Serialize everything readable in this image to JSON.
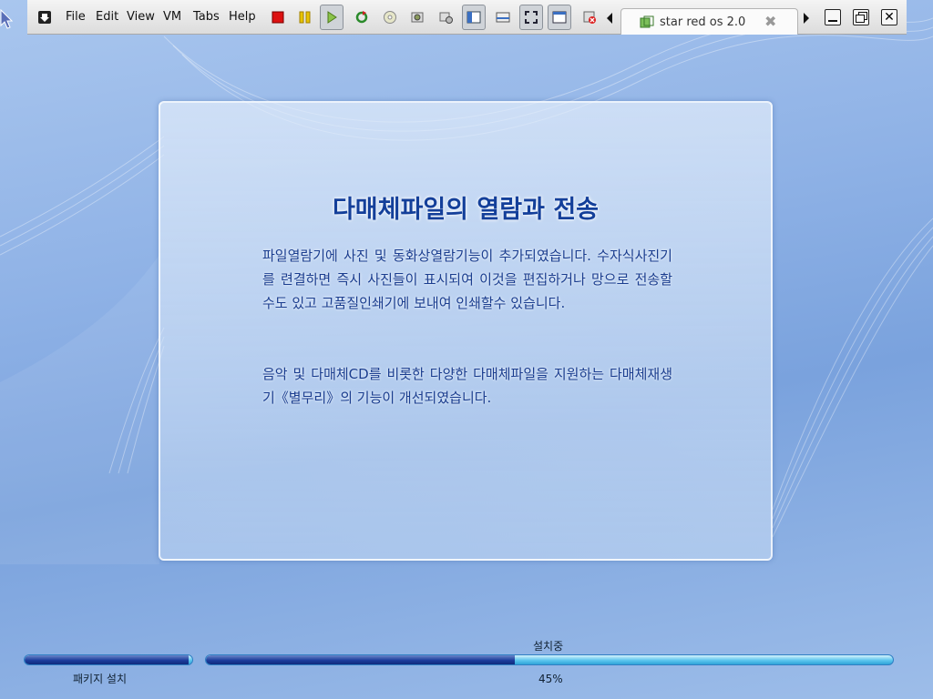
{
  "menu": [
    "File",
    "Edit",
    "View",
    "VM",
    "Tabs",
    "Help"
  ],
  "tab": {
    "label": "star red os 2.0"
  },
  "slide": {
    "title": "다매체파일의 열람과 전송",
    "paragraph1": "파일열람기에 사진 및 동화상열람기능이 추가되였습니다. 수자식사진기를 련결하면 즉시 사진들이 표시되여 이것을 편집하거나 망으로 전송할수도 있고 고품질인쇄기에 보내여 인쇄할수 있습니다.",
    "paragraph2": "음악 및 다매체CD를 비롯한 다양한 다매체파일을 지원하는 다매체재생기《별무리》의 기능이 개선되였습니다."
  },
  "progress": {
    "package_label": "패키지 설치",
    "package_fraction": 0.98,
    "overall_label": "설치중",
    "overall_percent_text": "45%",
    "overall_fraction": 0.45
  },
  "colors": {
    "title": "#133f9a",
    "body_text": "#1a3d8f",
    "progress_fill": "#1c3c9c",
    "progress_track": "#5cc6ee"
  },
  "icons": {
    "toolbar": [
      "grab-input-icon",
      "power-off-icon",
      "suspend-icon",
      "power-on-icon",
      "reset-icon",
      "cd-icon",
      "snapshot-icon",
      "snapshot-manager-icon",
      "sidebar-toggle-icon",
      "console-view-icon",
      "fullscreen-icon",
      "unity-icon",
      "close-tab-red-icon"
    ]
  }
}
